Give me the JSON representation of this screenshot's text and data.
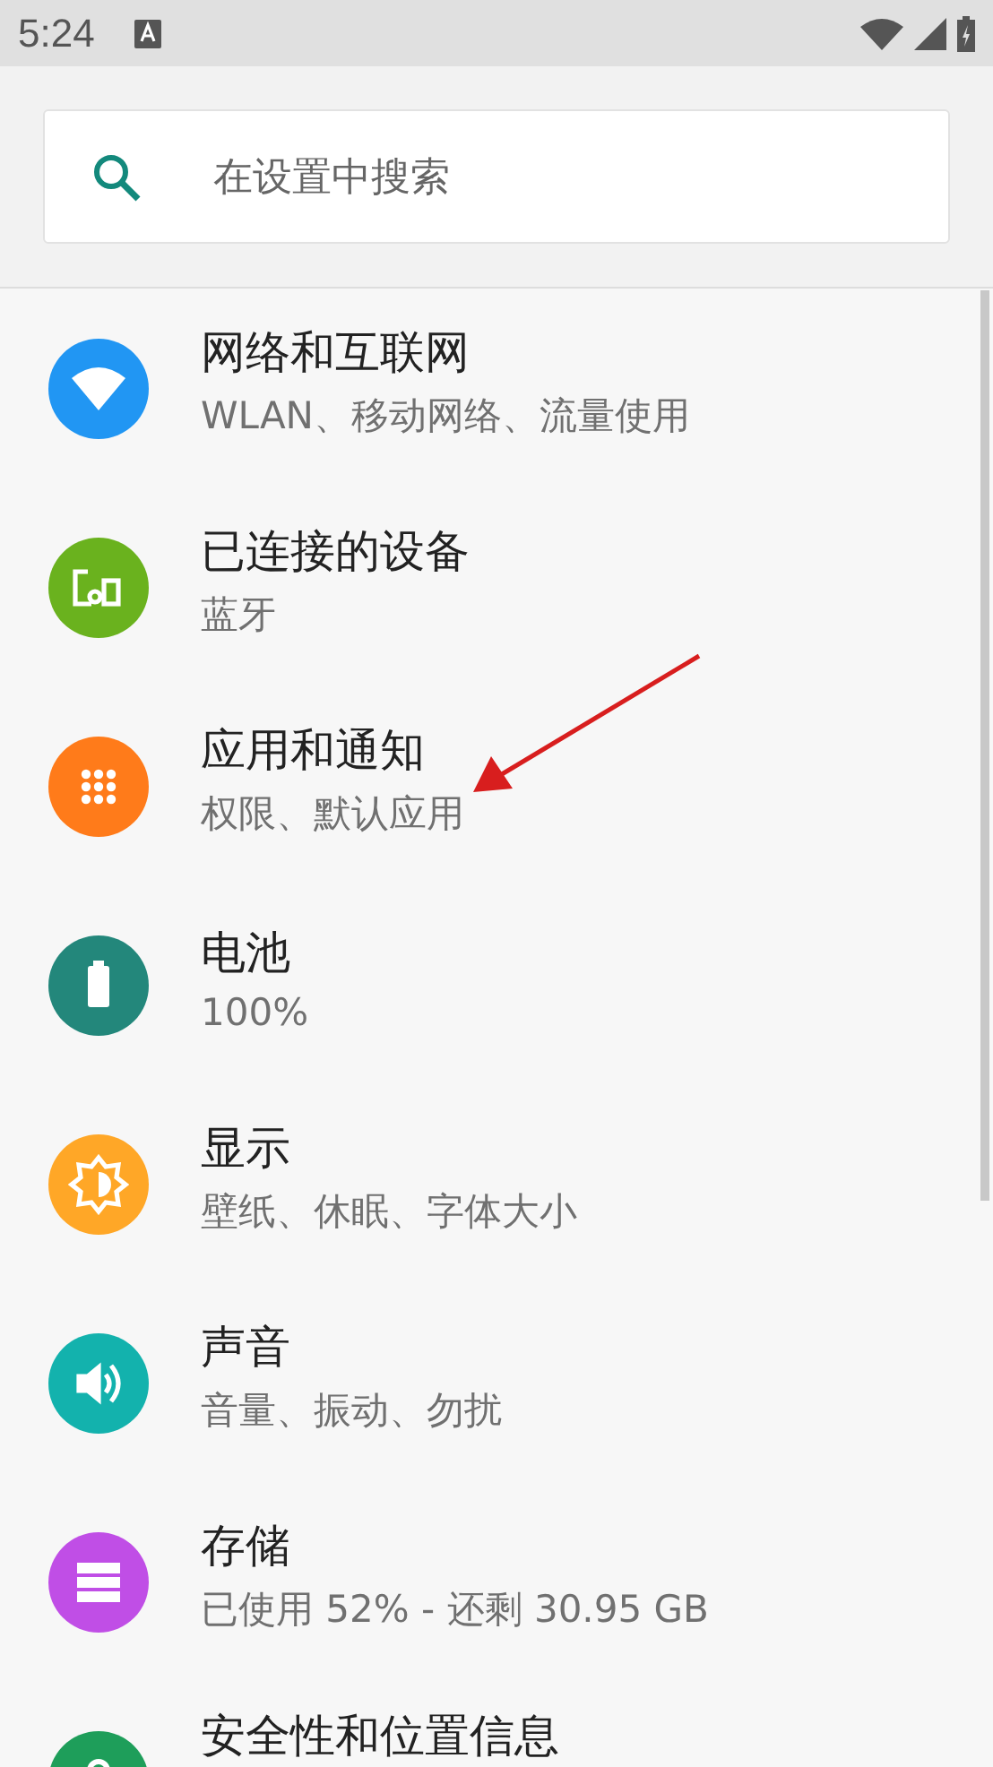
{
  "status_bar": {
    "time": "5:24"
  },
  "search": {
    "placeholder": "在设置中搜索"
  },
  "items": [
    {
      "title": "网络和互联网",
      "subtitle": "WLAN、移动网络、流量使用",
      "color": "#2196f3"
    },
    {
      "title": "已连接的设备",
      "subtitle": "蓝牙",
      "color": "#6ab21e"
    },
    {
      "title": "应用和通知",
      "subtitle": "权限、默认应用",
      "color": "#ff7b1a"
    },
    {
      "title": "电池",
      "subtitle": "100%",
      "color": "#23877b"
    },
    {
      "title": "显示",
      "subtitle": "壁纸、休眠、字体大小",
      "color": "#ffa727"
    },
    {
      "title": "声音",
      "subtitle": "音量、振动、勿扰",
      "color": "#13b2ad"
    },
    {
      "title": "存储",
      "subtitle": "已使用 52% - 还剩 30.95 GB",
      "color": "#c04ee6"
    },
    {
      "title": "安全性和位置信息",
      "color": "#1e9e5a"
    }
  ]
}
